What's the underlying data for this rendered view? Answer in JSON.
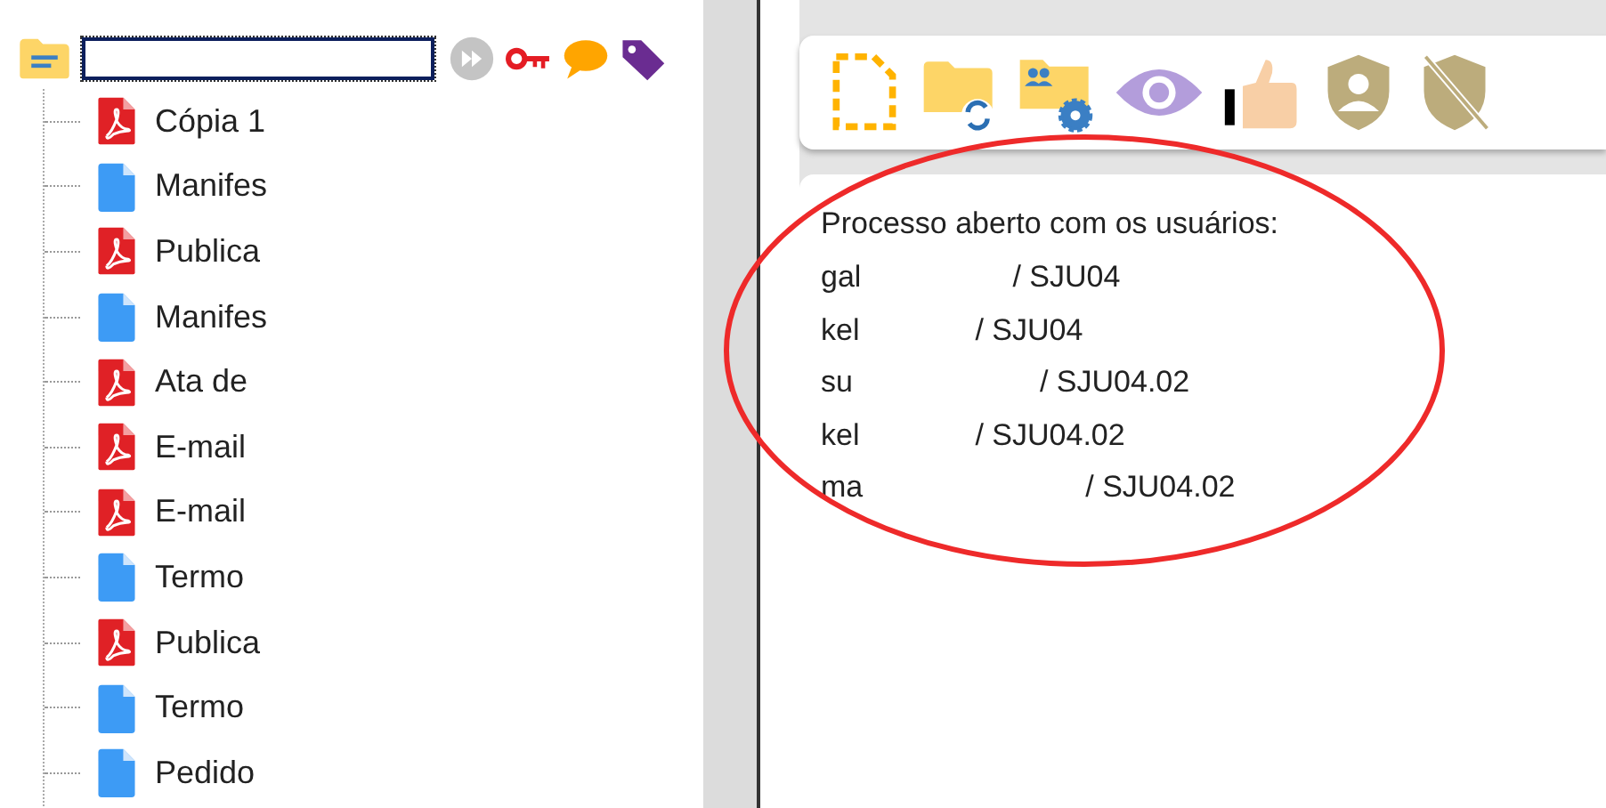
{
  "tree": [
    {
      "kind": "pdf",
      "label": "Cópia 1"
    },
    {
      "kind": "doc",
      "label": "Manifes"
    },
    {
      "kind": "pdf",
      "label": "Publica"
    },
    {
      "kind": "doc",
      "label": "Manifes"
    },
    {
      "kind": "pdf",
      "label": "Ata de"
    },
    {
      "kind": "pdf",
      "label": "E-mail"
    },
    {
      "kind": "pdf",
      "label": "E-mail"
    },
    {
      "kind": "doc",
      "label": "Termo"
    },
    {
      "kind": "pdf",
      "label": "Publica"
    },
    {
      "kind": "doc",
      "label": "Termo"
    },
    {
      "kind": "doc",
      "label": "Pedido"
    }
  ],
  "message": {
    "heading": "Processo aberto com os usuários:",
    "users": [
      {
        "name": "gal",
        "unit": "/ SJU04"
      },
      {
        "name": "kel",
        "unit": "/ SJU04"
      },
      {
        "name": "su",
        "unit": "/ SJU04.02"
      },
      {
        "name": "kel",
        "unit": "/ SJU04.02"
      },
      {
        "name": "ma",
        "unit": "/ SJU04.02"
      }
    ]
  }
}
